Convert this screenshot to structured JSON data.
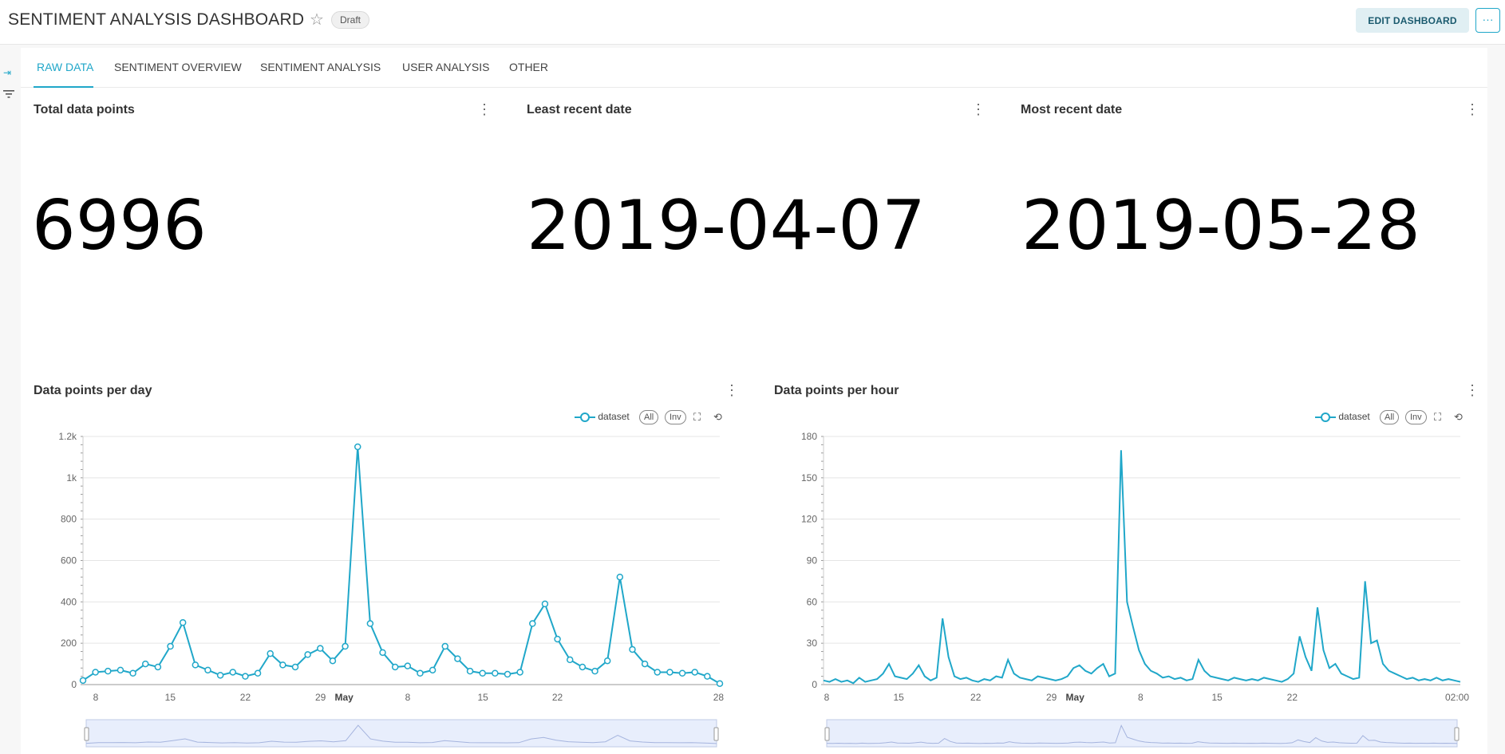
{
  "header": {
    "title": "SENTIMENT ANALYSIS DASHBOARD",
    "star_icon": "star-icon",
    "badge": "Draft",
    "edit_label": "EDIT DASHBOARD",
    "more_label": "···"
  },
  "sidebar": {
    "expand_icon": "expand-icon",
    "filter_icon": "filter-icon"
  },
  "tabs": [
    {
      "label": "RAW DATA",
      "active": true
    },
    {
      "label": "SENTIMENT OVERVIEW"
    },
    {
      "label": "SENTIMENT ANALYSIS"
    },
    {
      "label": "USER ANALYSIS"
    },
    {
      "label": "OTHER"
    }
  ],
  "kpis": [
    {
      "title": "Total data points",
      "value": "6996"
    },
    {
      "title": "Least recent date",
      "value": "2019-04-07"
    },
    {
      "title": "Most recent date",
      "value": "2019-05-28"
    }
  ],
  "charts_meta": {
    "legend_label": "dataset",
    "all_label": "All",
    "inv_label": "Inv",
    "accent": "#20a7c9"
  },
  "chart_data": [
    {
      "type": "line",
      "title": "Data points per day",
      "series": [
        {
          "name": "dataset",
          "values": [
            20,
            60,
            65,
            70,
            55,
            100,
            85,
            185,
            300,
            95,
            70,
            45,
            60,
            40,
            55,
            150,
            95,
            85,
            145,
            175,
            115,
            185,
            1150,
            295,
            155,
            85,
            90,
            55,
            70,
            185,
            125,
            65,
            55,
            55,
            50,
            60,
            295,
            390,
            220,
            120,
            85,
            65,
            115,
            520,
            170,
            100,
            60,
            60,
            55,
            60,
            40,
            5
          ]
        }
      ],
      "x": [
        "2019-04-07",
        "2019-04-08",
        "2019-04-09",
        "2019-04-10",
        "2019-04-11",
        "2019-04-12",
        "2019-04-13",
        "2019-04-14",
        "2019-04-15",
        "2019-04-16",
        "2019-04-17",
        "2019-04-18",
        "2019-04-19",
        "2019-04-20",
        "2019-04-21",
        "2019-04-22",
        "2019-04-23",
        "2019-04-24",
        "2019-04-25",
        "2019-04-26",
        "2019-04-27",
        "2019-04-28",
        "2019-04-29",
        "2019-04-30",
        "2019-05-01",
        "2019-05-02",
        "2019-05-03",
        "2019-05-04",
        "2019-05-05",
        "2019-05-06",
        "2019-05-07",
        "2019-05-08",
        "2019-05-09",
        "2019-05-10",
        "2019-05-11",
        "2019-05-12",
        "2019-05-13",
        "2019-05-14",
        "2019-05-15",
        "2019-05-16",
        "2019-05-17",
        "2019-05-18",
        "2019-05-19",
        "2019-05-20",
        "2019-05-21",
        "2019-05-22",
        "2019-05-23",
        "2019-05-24",
        "2019-05-25",
        "2019-05-26",
        "2019-05-27",
        "2019-05-28"
      ],
      "x_ticks": [
        "8",
        "15",
        "22",
        "29",
        "May",
        "8",
        "15",
        "22",
        "28"
      ],
      "y_ticks": [
        "0",
        "200",
        "400",
        "600",
        "800",
        "1k",
        "1.2k"
      ],
      "ylim": [
        0,
        1200
      ],
      "legend": "top-right",
      "grid": true
    },
    {
      "type": "line",
      "title": "Data points per hour",
      "series": [
        {
          "name": "dataset",
          "values": [
            3,
            2,
            4,
            2,
            3,
            1,
            5,
            2,
            3,
            4,
            8,
            15,
            6,
            5,
            4,
            8,
            14,
            6,
            3,
            5,
            48,
            20,
            6,
            4,
            5,
            3,
            2,
            4,
            3,
            6,
            5,
            18,
            8,
            5,
            4,
            3,
            6,
            5,
            4,
            3,
            4,
            6,
            12,
            14,
            10,
            8,
            12,
            15,
            6,
            8,
            170,
            60,
            42,
            25,
            15,
            10,
            8,
            5,
            6,
            4,
            5,
            3,
            4,
            18,
            10,
            6,
            5,
            4,
            3,
            5,
            4,
            3,
            4,
            3,
            5,
            4,
            3,
            2,
            4,
            8,
            35,
            20,
            10,
            56,
            25,
            12,
            15,
            8,
            6,
            4,
            5,
            75,
            30,
            32,
            15,
            10,
            8,
            6,
            4,
            5,
            3,
            4,
            3,
            5,
            3,
            4,
            3,
            2
          ]
        }
      ],
      "x_ticks": [
        "8",
        "15",
        "22",
        "29",
        "May",
        "8",
        "15",
        "22",
        "02:00"
      ],
      "y_ticks": [
        "0",
        "30",
        "60",
        "90",
        "120",
        "150",
        "180"
      ],
      "ylim": [
        0,
        180
      ],
      "legend": "top-right",
      "grid": true
    }
  ]
}
